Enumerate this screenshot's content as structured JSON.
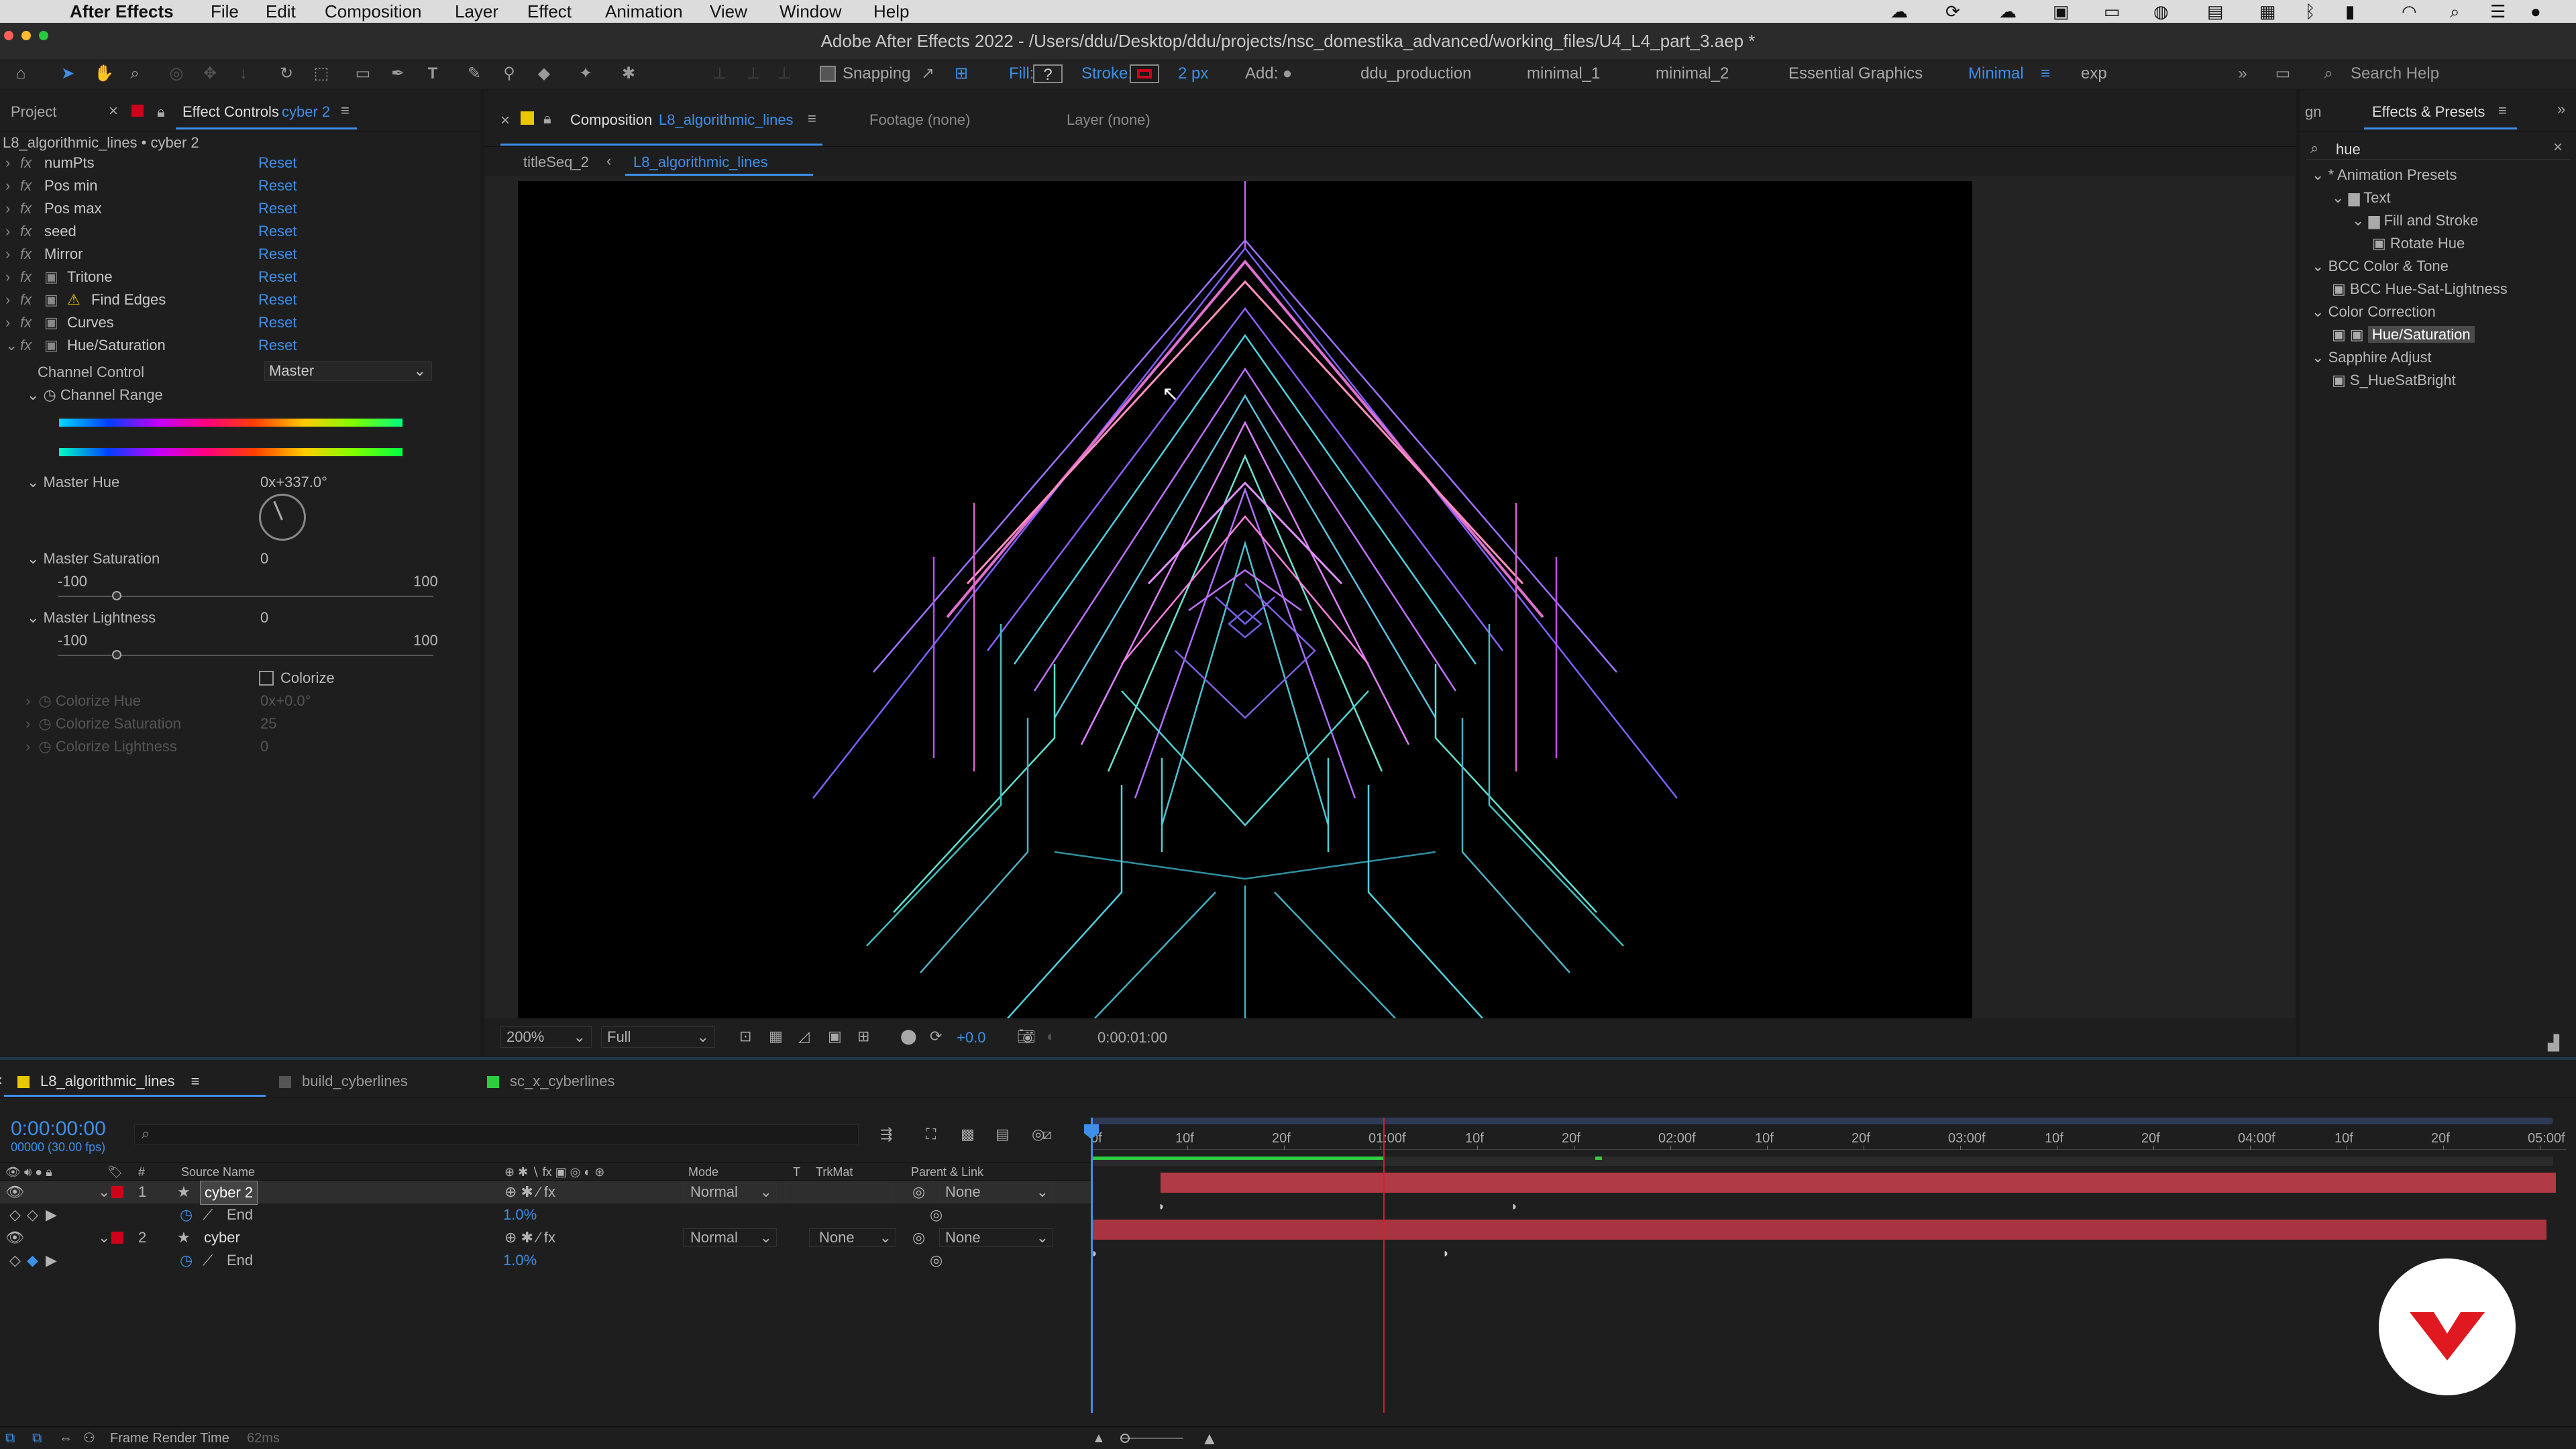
{
  "menubar": {
    "app_name": "After Effects",
    "items": [
      "File",
      "Edit",
      "Composition",
      "Layer",
      "Effect",
      "Animation",
      "View",
      "Window",
      "Help"
    ]
  },
  "window": {
    "title": "Adobe After Effects 2022 - /Users/ddu/Desktop/ddu/projects/nsc_domestika_advanced/working_files/U4_L4_part_3.aep *"
  },
  "toolbar": {
    "snapping_label": "Snapping",
    "fill_label": "Fill:",
    "fill_value": "?",
    "stroke_label": "Stroke:",
    "stroke_width": "2 px",
    "add_label": "Add:",
    "workspaces": [
      "ddu_production",
      "minimal_1",
      "minimal_2",
      "Essential Graphics",
      "Minimal",
      "exp"
    ],
    "active_workspace": "Minimal",
    "search_placeholder": "Search Help",
    "accent_color": "#3f8fe8",
    "stroke_color": "#d0021b"
  },
  "left_panel": {
    "tab_project": "Project",
    "tab_effect_controls": "Effect Controls",
    "tab_effect_controls_layer": "cyber 2",
    "breadcrumb": "L8_algorithmic_lines • cyber 2",
    "reset_label": "Reset",
    "effects": [
      {
        "name": "numPts",
        "warn": false,
        "icon": false
      },
      {
        "name": "Pos min",
        "warn": false,
        "icon": false
      },
      {
        "name": "Pos max",
        "warn": false,
        "icon": false
      },
      {
        "name": "seed",
        "warn": false,
        "icon": false
      },
      {
        "name": "Mirror",
        "warn": false,
        "icon": false
      },
      {
        "name": "Tritone",
        "warn": false,
        "icon": true
      },
      {
        "name": "Find Edges",
        "warn": true,
        "icon": true
      },
      {
        "name": "Curves",
        "warn": false,
        "icon": true
      },
      {
        "name": "Hue/Saturation",
        "warn": false,
        "icon": true
      }
    ],
    "hue_sat": {
      "channel_control_label": "Channel Control",
      "channel_control_value": "Master",
      "channel_range_label": "Channel Range",
      "master_hue_label": "Master Hue",
      "master_hue_value": "0x+337.0°",
      "master_saturation_label": "Master Saturation",
      "master_saturation_value": "0",
      "master_lightness_label": "Master Lightness",
      "master_lightness_value": "0",
      "slider_min": "-100",
      "slider_max": "100",
      "saturation_level_pct": 50,
      "lightness_level_pct": 50,
      "colorize_label": "Colorize",
      "colorize_hue_label": "Colorize Hue",
      "colorize_hue_value": "0x+0.0°",
      "colorize_saturation_label": "Colorize Saturation",
      "colorize_saturation_value": "25",
      "colorize_lightness_label": "Colorize Lightness",
      "colorize_lightness_value": "0"
    }
  },
  "composition": {
    "tab_label": "Composition",
    "tab_name": "L8_algorithmic_lines",
    "footage_tab": "Footage (none)",
    "layer_tab": "Layer (none)",
    "breadcrumbs": [
      "titleSeq_2",
      "L8_algorithmic_lines"
    ],
    "zoom": "200%",
    "resolution": "Full",
    "exposure": "+0.0",
    "timecode": "0:00:01:00"
  },
  "effects_presets": {
    "tab_partial": "gn",
    "title": "Effects & Presets",
    "search_value": "hue",
    "tree": [
      {
        "label": "* Animation Presets",
        "level": 0,
        "type": "group"
      },
      {
        "label": "Text",
        "level": 1,
        "type": "folder"
      },
      {
        "label": "Fill and Stroke",
        "level": 2,
        "type": "folder"
      },
      {
        "label": "Rotate Hue",
        "level": 3,
        "type": "preset"
      },
      {
        "label": "BCC Color & Tone",
        "level": 0,
        "type": "group"
      },
      {
        "label": "BCC Hue-Sat-Lightness",
        "level": 1,
        "type": "effect"
      },
      {
        "label": "Color Correction",
        "level": 0,
        "type": "group"
      },
      {
        "label": "Hue/Saturation",
        "level": 1,
        "type": "effect",
        "selected": true
      },
      {
        "label": "Sapphire Adjust",
        "level": 0,
        "type": "group"
      },
      {
        "label": "S_HueSatBright",
        "level": 1,
        "type": "effect"
      }
    ]
  },
  "timeline": {
    "tabs": [
      {
        "label": "L8_algorithmic_lines",
        "color": "#e8c800",
        "active": true
      },
      {
        "label": "build_cyberlines",
        "color": "#555555",
        "active": false
      },
      {
        "label": "sc_x_cyberlines",
        "color": "#2ecc40",
        "active": false
      }
    ],
    "current_time": "0:00:00:00",
    "frame_info": "00000 (30.00 fps)",
    "columns": {
      "source_name": "Source Name",
      "mode": "Mode",
      "t": "T",
      "trkmat": "TrkMat",
      "parent_link": "Parent & Link"
    },
    "layers": [
      {
        "num": "1",
        "name": "cyber 2",
        "mode": "Normal",
        "trkmat": "",
        "parent": "None",
        "prop": "End",
        "prop_value": "1.0%",
        "selected": true
      },
      {
        "num": "2",
        "name": "cyber",
        "mode": "Normal",
        "trkmat": "None",
        "parent": "None",
        "prop": "End",
        "prop_value": "1.0%",
        "selected": false
      }
    ],
    "ruler_labels": [
      "0f",
      "10f",
      "20f",
      "01:00f",
      "10f",
      "20f",
      "02:00f",
      "10f",
      "20f",
      "03:00f",
      "10f",
      "20f",
      "04:00f",
      "10f",
      "20f",
      "05:00f"
    ],
    "layer_bar_color": "#b03a45",
    "footer_label": "Frame Render Time",
    "footer_value": "62ms"
  }
}
